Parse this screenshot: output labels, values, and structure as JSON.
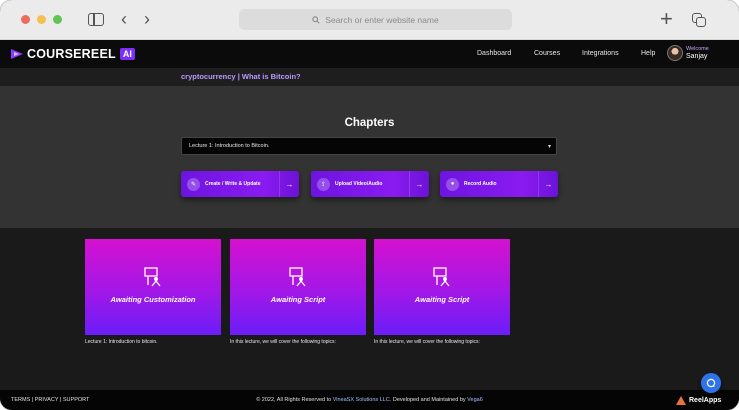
{
  "browser": {
    "url_placeholder": "Search or enter website name"
  },
  "header": {
    "logo_text": "COURSEREEL",
    "logo_badge": "AI",
    "nav": [
      "Dashboard",
      "Courses",
      "Integrations",
      "Help"
    ],
    "welcome": "Welcome",
    "user_name": "Sanjay"
  },
  "breadcrumb": "cryptocurrency | What is Bitcoin?",
  "chapters": {
    "title": "Chapters",
    "selected_lecture": "Lecture 1: Introduction to Bitcoin.",
    "actions": [
      {
        "label": "Create / Write & Update",
        "icon": "edit-icon"
      },
      {
        "label": "Upload Video/Audio",
        "icon": "upload-icon"
      },
      {
        "label": "Record Audio",
        "icon": "record-icon"
      }
    ]
  },
  "cards": [
    {
      "status": "Awaiting Customization",
      "caption": "Lecture 1: Introduction to bitcoin."
    },
    {
      "status": "Awaiting Script",
      "caption": "In this lecture, we will cover the following topics:"
    },
    {
      "status": "Awaiting Script",
      "caption": "In this lecture, we will cover the following topics:"
    }
  ],
  "footer": {
    "links": [
      "TERMS",
      "PRIVACY",
      "SUPPORT"
    ],
    "copyright_prefix": "© 2022, All Rights Reserved to ",
    "company": "VineaSX Solutions LLC.",
    "copyright_mid": " Developed and Maintained by ",
    "developer": "Vega6",
    "brand": "ReelApps"
  },
  "colors": {
    "accent_purple": "#8a1bf0",
    "card_gradient_top": "#d511cf",
    "card_gradient_bottom": "#6b1ef8",
    "link_blue": "#9ec2ff"
  }
}
